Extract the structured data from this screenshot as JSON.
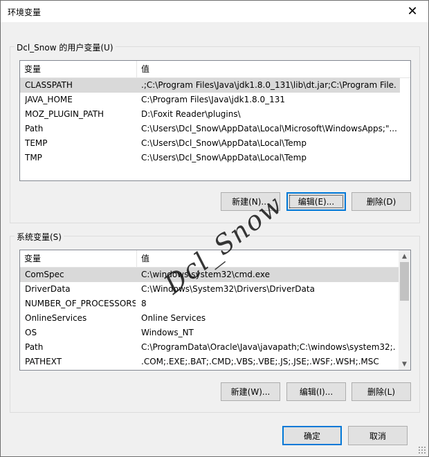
{
  "window": {
    "title": "环境变量",
    "close_glyph": "✕"
  },
  "user_vars": {
    "group_label": "Dcl_Snow 的用户变量(U)",
    "headers": {
      "name": "变量",
      "value": "值"
    },
    "rows": [
      {
        "name": "CLASSPATH",
        "value": ".;C:\\Program Files\\Java\\jdk1.8.0_131\\lib\\dt.jar;C:\\Program File..."
      },
      {
        "name": "JAVA_HOME",
        "value": "C:\\Program Files\\Java\\jdk1.8.0_131"
      },
      {
        "name": "MOZ_PLUGIN_PATH",
        "value": "D:\\Foxit Reader\\plugins\\"
      },
      {
        "name": "Path",
        "value": "C:\\Users\\Dcl_Snow\\AppData\\Local\\Microsoft\\WindowsApps;\"..."
      },
      {
        "name": "TEMP",
        "value": "C:\\Users\\Dcl_Snow\\AppData\\Local\\Temp"
      },
      {
        "name": "TMP",
        "value": "C:\\Users\\Dcl_Snow\\AppData\\Local\\Temp"
      }
    ],
    "selected_index": 0,
    "buttons": {
      "new": "新建(N)...",
      "edit": "编辑(E)...",
      "delete": "删除(D)"
    }
  },
  "system_vars": {
    "group_label": "系统变量(S)",
    "headers": {
      "name": "变量",
      "value": "值"
    },
    "rows": [
      {
        "name": "ComSpec",
        "value": "C:\\windows\\system32\\cmd.exe"
      },
      {
        "name": "DriverData",
        "value": "C:\\Windows\\System32\\Drivers\\DriverData"
      },
      {
        "name": "NUMBER_OF_PROCESSORS",
        "value": "8"
      },
      {
        "name": "OnlineServices",
        "value": "Online Services"
      },
      {
        "name": "OS",
        "value": "Windows_NT"
      },
      {
        "name": "Path",
        "value": "C:\\ProgramData\\Oracle\\Java\\javapath;C:\\windows\\system32;..."
      },
      {
        "name": "PATHEXT",
        "value": ".COM;.EXE;.BAT;.CMD;.VBS;.VBE;.JS;.JSE;.WSF;.WSH;.MSC"
      }
    ],
    "selected_index": 0,
    "buttons": {
      "new": "新建(W)...",
      "edit": "编辑(I)...",
      "delete": "删除(L)"
    },
    "scroll_up_glyph": "▲",
    "scroll_down_glyph": "▼"
  },
  "footer": {
    "ok": "确定",
    "cancel": "取消"
  },
  "watermark": "Dcl_Snow",
  "colors": {
    "focus_accent": "#0078d7",
    "selection": "#d9d9d9"
  }
}
